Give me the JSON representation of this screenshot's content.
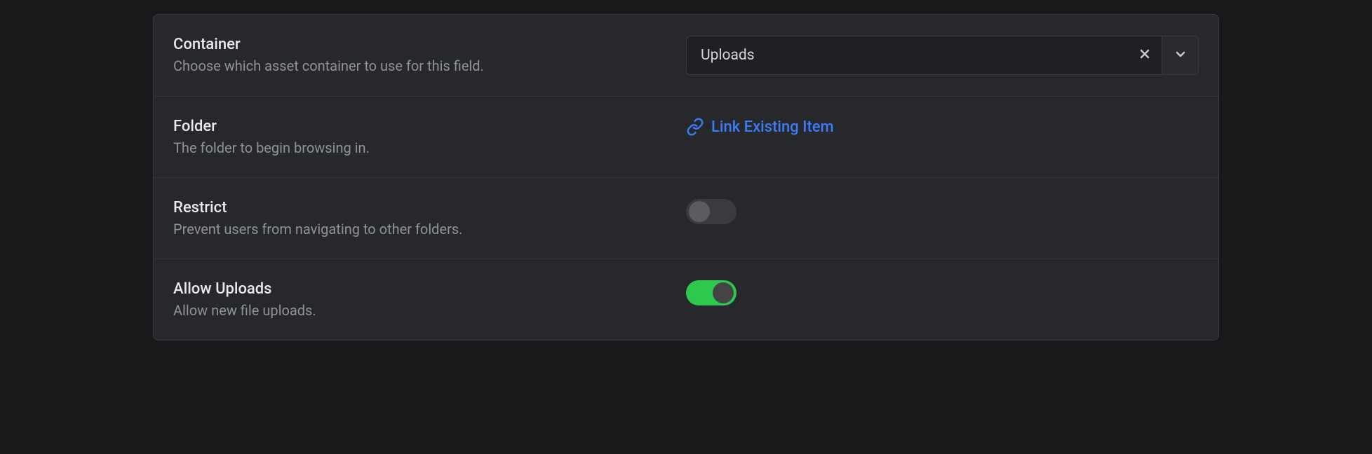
{
  "fields": {
    "container": {
      "label": "Container",
      "description": "Choose which asset container to use for this field.",
      "value": "Uploads"
    },
    "folder": {
      "label": "Folder",
      "description": "The folder to begin browsing in.",
      "linkAction": "Link Existing Item"
    },
    "restrict": {
      "label": "Restrict",
      "description": "Prevent users from navigating to other folders.",
      "enabled": false
    },
    "allowUploads": {
      "label": "Allow Uploads",
      "description": "Allow new file uploads.",
      "enabled": true
    }
  }
}
